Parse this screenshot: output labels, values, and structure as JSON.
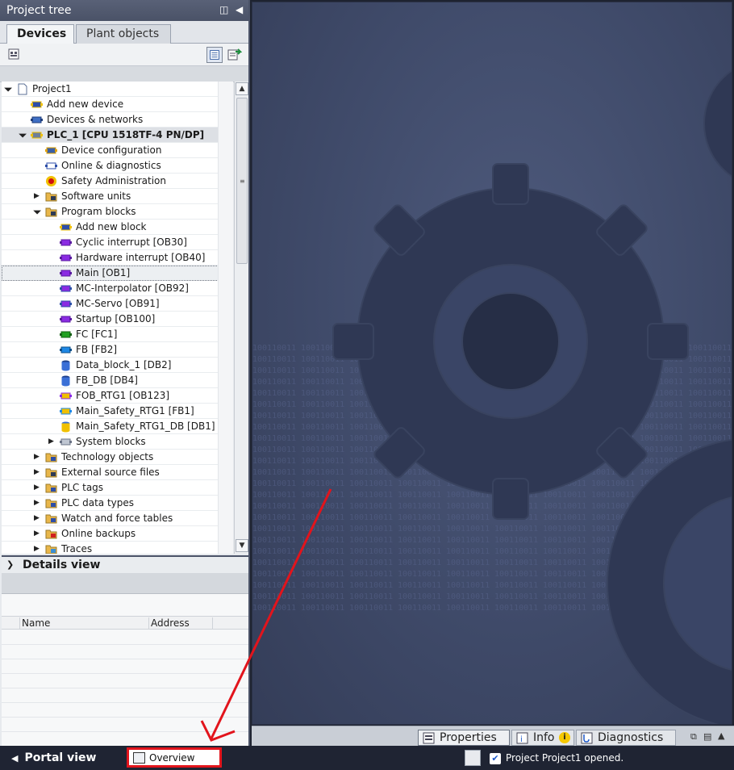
{
  "project_tree": {
    "title": "Project tree",
    "tabs": [
      {
        "label": "Devices"
      },
      {
        "label": "Plant objects"
      }
    ],
    "items": [
      {
        "label": "Project1",
        "level": 0,
        "toggle": "open",
        "icon": "project-icon",
        "bold": false
      },
      {
        "label": "Add new device",
        "level": 1,
        "toggle": "none",
        "icon": "add-device-icon",
        "bold": false
      },
      {
        "label": "Devices & networks",
        "level": 1,
        "toggle": "none",
        "icon": "network-icon",
        "bold": false
      },
      {
        "label": "PLC_1 [CPU 1518TF-4 PN/DP]",
        "level": 1,
        "toggle": "open",
        "icon": "plc-icon",
        "bold": true
      },
      {
        "label": "Device configuration",
        "level": 2,
        "toggle": "none",
        "icon": "device-config-icon",
        "bold": false
      },
      {
        "label": "Online & diagnostics",
        "level": 2,
        "toggle": "none",
        "icon": "diagnostics-icon",
        "bold": false
      },
      {
        "label": "Safety Administration",
        "level": 2,
        "toggle": "none",
        "icon": "safety-icon",
        "bold": false
      },
      {
        "label": "Software units",
        "level": 2,
        "toggle": "closed",
        "icon": "folder-units-icon",
        "bold": false
      },
      {
        "label": "Program blocks",
        "level": 2,
        "toggle": "open",
        "icon": "folder-blocks-icon",
        "bold": false
      },
      {
        "label": "Add new block",
        "level": 3,
        "toggle": "none",
        "icon": "add-block-icon",
        "bold": false
      },
      {
        "label": "Cyclic interrupt [OB30]",
        "level": 3,
        "toggle": "none",
        "icon": "ob-icon",
        "bold": false
      },
      {
        "label": "Hardware interrupt [OB40]",
        "level": 3,
        "toggle": "none",
        "icon": "ob-icon",
        "bold": false
      },
      {
        "label": "Main [OB1]",
        "level": 3,
        "toggle": "none",
        "icon": "ob-icon",
        "bold": false,
        "selected": true
      },
      {
        "label": "MC-Interpolator [OB92]",
        "level": 3,
        "toggle": "none",
        "icon": "ob-mc-icon",
        "bold": false
      },
      {
        "label": "MC-Servo [OB91]",
        "level": 3,
        "toggle": "none",
        "icon": "ob-mc-icon",
        "bold": false
      },
      {
        "label": "Startup [OB100]",
        "level": 3,
        "toggle": "none",
        "icon": "ob-icon",
        "bold": false
      },
      {
        "label": "FC [FC1]",
        "level": 3,
        "toggle": "none",
        "icon": "fc-icon",
        "bold": false
      },
      {
        "label": "FB [FB2]",
        "level": 3,
        "toggle": "none",
        "icon": "fb-icon",
        "bold": false
      },
      {
        "label": "Data_block_1 [DB2]",
        "level": 3,
        "toggle": "none",
        "icon": "db-icon",
        "bold": false
      },
      {
        "label": "FB_DB [DB4]",
        "level": 3,
        "toggle": "none",
        "icon": "db-icon",
        "bold": false
      },
      {
        "label": "FOB_RTG1 [OB123]",
        "level": 3,
        "toggle": "none",
        "icon": "safety-ob-icon",
        "bold": false
      },
      {
        "label": "Main_Safety_RTG1 [FB1]",
        "level": 3,
        "toggle": "none",
        "icon": "safety-fb-icon",
        "bold": false
      },
      {
        "label": "Main_Safety_RTG1_DB [DB1]",
        "level": 3,
        "toggle": "none",
        "icon": "safety-db-icon",
        "bold": false
      },
      {
        "label": "System blocks",
        "level": 3,
        "toggle": "closed",
        "icon": "system-blocks-icon",
        "bold": false
      },
      {
        "label": "Technology objects",
        "level": 2,
        "toggle": "closed",
        "icon": "folder-tech-icon",
        "bold": false
      },
      {
        "label": "External source files",
        "level": 2,
        "toggle": "closed",
        "icon": "folder-ext-icon",
        "bold": false
      },
      {
        "label": "PLC tags",
        "level": 2,
        "toggle": "closed",
        "icon": "folder-tags-icon",
        "bold": false
      },
      {
        "label": "PLC data types",
        "level": 2,
        "toggle": "closed",
        "icon": "folder-types-icon",
        "bold": false
      },
      {
        "label": "Watch and force tables",
        "level": 2,
        "toggle": "closed",
        "icon": "folder-watch-icon",
        "bold": false
      },
      {
        "label": "Online backups",
        "level": 2,
        "toggle": "closed",
        "icon": "folder-backup-icon",
        "bold": false
      },
      {
        "label": "Traces",
        "level": 2,
        "toggle": "closed",
        "icon": "folder-traces-icon",
        "bold": false
      }
    ]
  },
  "details_view": {
    "title": "Details view",
    "columns": [
      "Name",
      "Address"
    ]
  },
  "inspector": {
    "tabs": [
      {
        "label": "Properties"
      },
      {
        "label": "Info"
      },
      {
        "label": "Diagnostics"
      }
    ]
  },
  "statusbar": {
    "portal_label": "Portal view",
    "overview_label": "Overview",
    "message": "Project Project1 opened."
  },
  "colors": {
    "accent_red": "#e2141c",
    "main_bg": "#434e6e",
    "panel_header": "#4f576c"
  }
}
